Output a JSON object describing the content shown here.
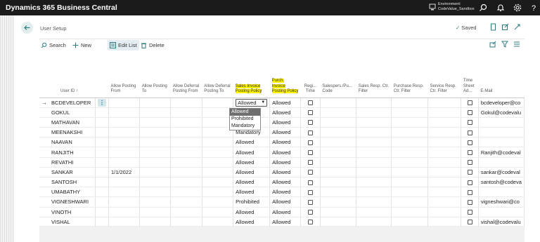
{
  "app": {
    "title": "Dynamics 365 Business Central",
    "environment_label": "Environment:",
    "environment_value": "CodeValue_Sandbox"
  },
  "page": {
    "title": "User Setup",
    "saved_label": "Saved"
  },
  "actions": {
    "search": "Search",
    "new": "New",
    "edit_list": "Edit List",
    "delete": "Delete"
  },
  "columns": [
    {
      "label": "User ID ↑"
    },
    {
      "label": "Allow Posting From"
    },
    {
      "label": "Allow Posting To"
    },
    {
      "label": "Allow Deferral Posting From"
    },
    {
      "label": "Allow Deferral Posting To"
    },
    {
      "label": "Sales Invoice Posting Policy",
      "highlighted": true
    },
    {
      "label": "Purch. Invoice Posting Policy",
      "highlighted": true
    },
    {
      "label": "Regi... Time"
    },
    {
      "label": "Salespers./Pu... Code"
    },
    {
      "label": "Sales Resp. Ctr. Filter"
    },
    {
      "label": "Purchase Resp. Ctr. Filter"
    },
    {
      "label": "Service Resp. Ctr. Filter"
    },
    {
      "label": "Time Sheet Ad..."
    },
    {
      "label": "E-Mail"
    }
  ],
  "rows": [
    {
      "user_id": "BCDEVELOPER",
      "allow_posting_from": "",
      "sales_policy": "Allowed",
      "purch_policy": "Allowed",
      "email": "bcdeveloper@co"
    },
    {
      "user_id": "GOKUL",
      "allow_posting_from": "",
      "sales_policy": "Allowed",
      "purch_policy": "Allowed",
      "email": "Gokul@codevalu"
    },
    {
      "user_id": "MATHAVAN",
      "allow_posting_from": "",
      "sales_policy": "Prohibited",
      "purch_policy": "Allowed",
      "email": ""
    },
    {
      "user_id": "MEENAKSHI",
      "allow_posting_from": "",
      "sales_policy": "Mandatory",
      "purch_policy": "Allowed",
      "email": ""
    },
    {
      "user_id": "NAAVAN",
      "allow_posting_from": "",
      "sales_policy": "Allowed",
      "purch_policy": "Allowed",
      "email": ""
    },
    {
      "user_id": "RANJITH",
      "allow_posting_from": "",
      "sales_policy": "Allowed",
      "purch_policy": "Allowed",
      "email": "Ranjith@codeval"
    },
    {
      "user_id": "REVATHI",
      "allow_posting_from": "",
      "sales_policy": "Allowed",
      "purch_policy": "Allowed",
      "email": ""
    },
    {
      "user_id": "SANKAR",
      "allow_posting_from": "1/1/2022",
      "sales_policy": "Allowed",
      "purch_policy": "Allowed",
      "email": "sankar@codeval"
    },
    {
      "user_id": "SANTOSH",
      "allow_posting_from": "",
      "sales_policy": "Allowed",
      "purch_policy": "Allowed",
      "email": "santosh@codeva"
    },
    {
      "user_id": "UMABATHY",
      "allow_posting_from": "",
      "sales_policy": "Allowed",
      "purch_policy": "Allowed",
      "email": ""
    },
    {
      "user_id": "VIGNESHWARI",
      "allow_posting_from": "",
      "sales_policy": "Prohibited",
      "purch_policy": "Allowed",
      "email": "vigneshwari@co"
    },
    {
      "user_id": "VINOTH",
      "allow_posting_from": "",
      "sales_policy": "Allowed",
      "purch_policy": "Allowed",
      "email": ""
    },
    {
      "user_id": "VISHAL",
      "allow_posting_from": "",
      "sales_policy": "Allowed",
      "purch_policy": "Allowed",
      "email": "vishal@codevalu"
    }
  ],
  "dropdown": {
    "options": [
      "Allowed",
      "Prohibited",
      "Mandatory"
    ],
    "selected": "Allowed"
  },
  "colors": {
    "topbar": "#1b1b1b",
    "accent": "#2c7a7b",
    "highlight": "#fff200"
  },
  "icons": [
    "back-arrow-icon",
    "search-icon",
    "plus-icon",
    "edit-list-icon",
    "trash-icon",
    "share-icon",
    "filter-icon",
    "list-view-icon",
    "bookmark-icon",
    "open-new-window-icon",
    "collapse-icon",
    "bell-icon",
    "gear-icon",
    "help-icon",
    "environment-icon"
  ]
}
